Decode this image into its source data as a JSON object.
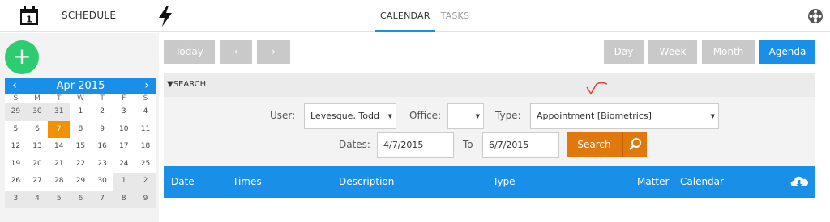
{
  "app": {
    "label": "SCHEDULE",
    "calendar_icon_day": "1"
  },
  "topnav": {
    "calendar": "CALENDAR",
    "tasks": "TASKS"
  },
  "toolbar": {
    "today": "Today",
    "prev": "‹",
    "next": "›",
    "day": "Day",
    "week": "Week",
    "month": "Month",
    "agenda": "Agenda"
  },
  "mini_calendar": {
    "title": "Apr 2015",
    "prev": "‹",
    "next": "›",
    "dow": [
      "S",
      "M",
      "T",
      "W",
      "T",
      "F",
      "S"
    ],
    "weeks": [
      [
        "29",
        "30",
        "31",
        "1",
        "2",
        "3",
        "4"
      ],
      [
        "5",
        "6",
        "7",
        "8",
        "9",
        "10",
        "11"
      ],
      [
        "12",
        "13",
        "14",
        "15",
        "16",
        "17",
        "18"
      ],
      [
        "19",
        "20",
        "21",
        "22",
        "23",
        "24",
        "25"
      ],
      [
        "26",
        "27",
        "28",
        "29",
        "30",
        "1",
        "2"
      ],
      [
        "3",
        "4",
        "5",
        "6",
        "7",
        "8",
        "9"
      ]
    ],
    "selected": "7"
  },
  "search": {
    "section_label": "SEARCH",
    "user_label": "User:",
    "user_value": "Levesque, Todd",
    "office_label": "Office:",
    "office_value": "",
    "type_label": "Type:",
    "type_value": "Appointment [Biometrics]",
    "dates_label": "Dates:",
    "date_from": "4/7/2015",
    "to_label": "To",
    "date_to": "6/7/2015",
    "search_button": "Search"
  },
  "results": {
    "columns": [
      "Date",
      "Times",
      "Description",
      "Type",
      "Matter",
      "Calendar"
    ]
  },
  "colors": {
    "accent": "#1a8fe8",
    "fab": "#2ecc71",
    "search": "#e0780c",
    "selected_day": "#f39200"
  }
}
